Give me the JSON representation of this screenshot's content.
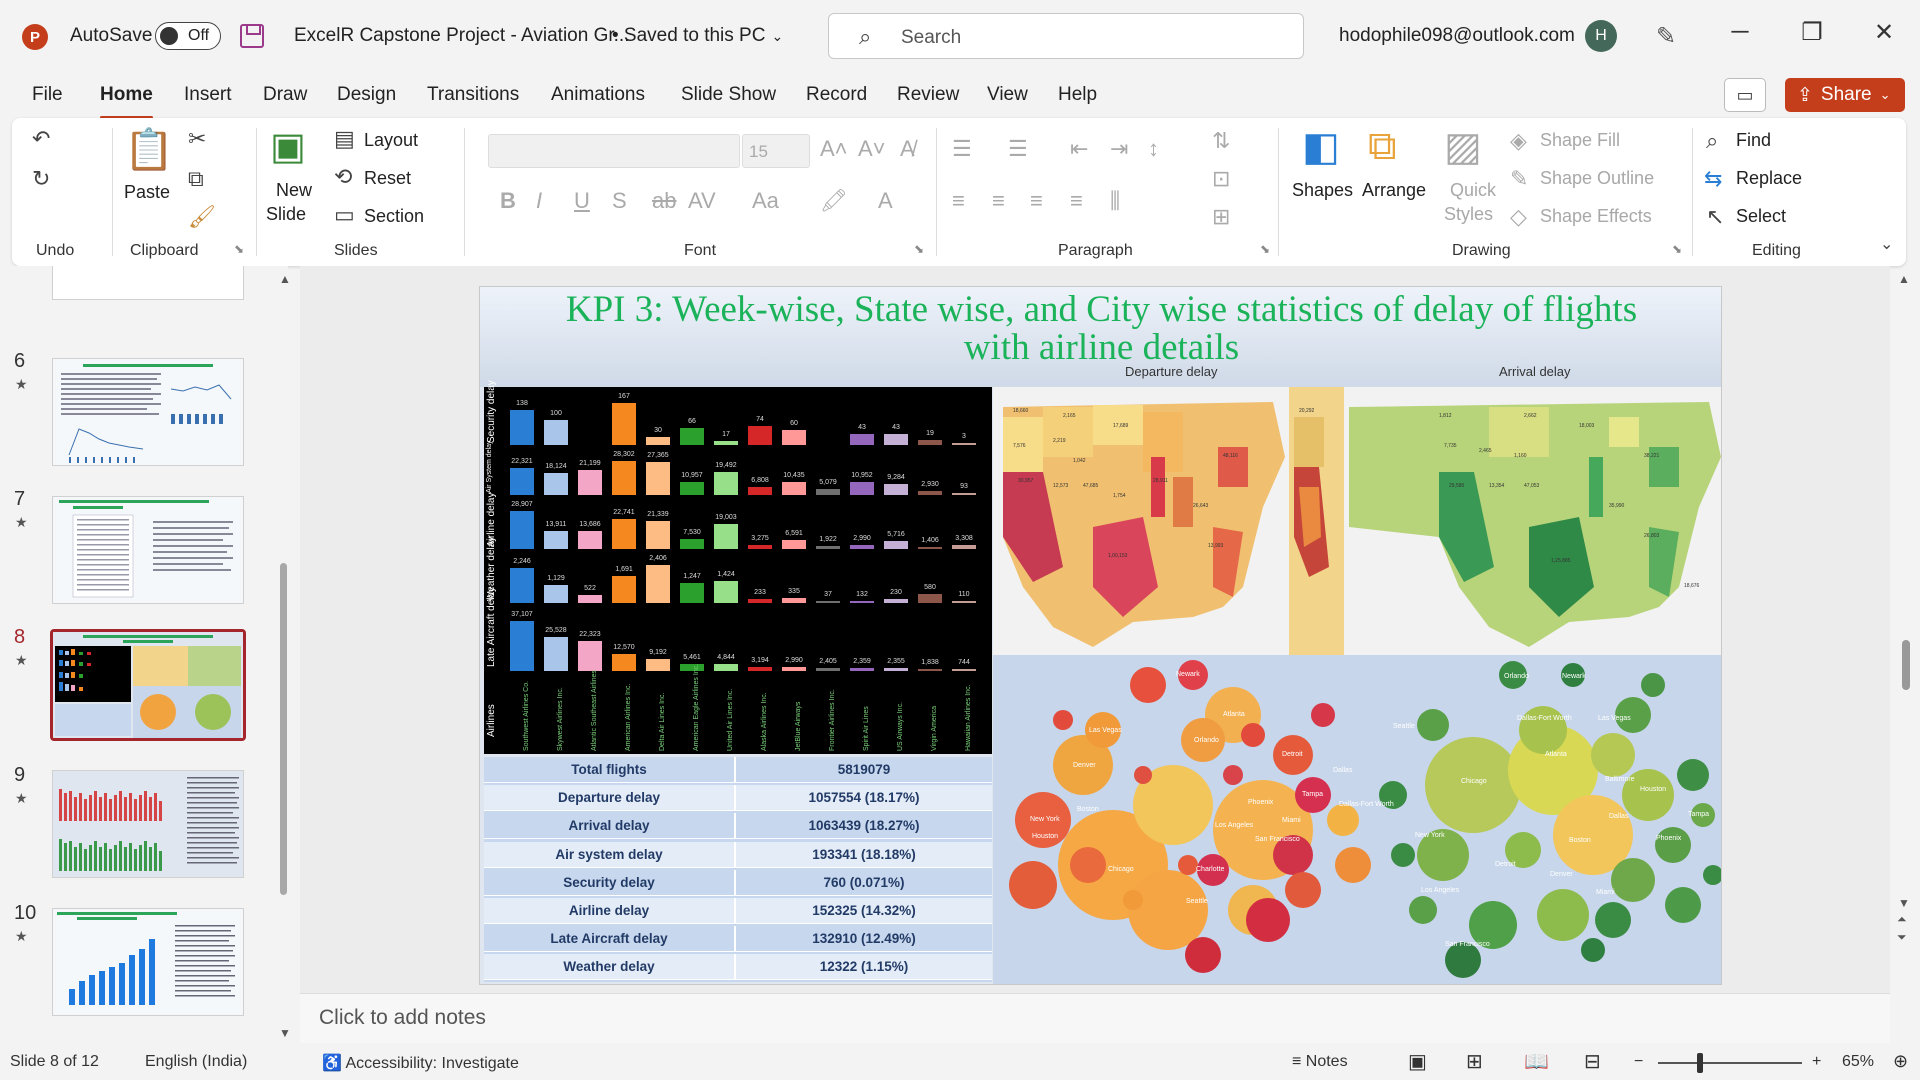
{
  "titlebar": {
    "app_icon": "P",
    "autosave_label": "AutoSave",
    "autosave_state": "Off",
    "doc_title": "ExcelR Capstone Project - Aviation Gr...",
    "doc_status": "• Saved to this PC",
    "search_placeholder": "Search",
    "account": "hodophile098@outlook.com",
    "avatar_initial": "H"
  },
  "menu": {
    "tabs": [
      "File",
      "Home",
      "Insert",
      "Draw",
      "Design",
      "Transitions",
      "Animations",
      "Slide Show",
      "Record",
      "Review",
      "View",
      "Help"
    ],
    "active": "Home",
    "share_label": "Share"
  },
  "ribbon": {
    "groups": {
      "undo": "Undo",
      "clipboard": "Clipboard",
      "slides": "Slides",
      "font": "Font",
      "paragraph": "Paragraph",
      "drawing": "Drawing",
      "editing": "Editing"
    },
    "paste": "Paste",
    "new_slide_1": "New",
    "new_slide_2": "Slide",
    "layout": "Layout",
    "reset": "Reset",
    "section": "Section",
    "font_size": "15",
    "shapes": "Shapes",
    "arrange": "Arrange",
    "quick_styles_1": "Quick",
    "quick_styles_2": "Styles",
    "shape_fill": "Shape Fill",
    "shape_outline": "Shape Outline",
    "shape_effects": "Shape Effects",
    "find": "Find",
    "replace": "Replace",
    "select": "Select"
  },
  "thumbnails": [
    {
      "num": "6",
      "selected": false
    },
    {
      "num": "7",
      "selected": false
    },
    {
      "num": "8",
      "selected": true
    },
    {
      "num": "9",
      "selected": false
    },
    {
      "num": "10",
      "selected": false
    }
  ],
  "slide": {
    "title_line1": "KPI 3: Week-wise, State wise, and City wise statistics of delay of flights",
    "title_line2": "with airline details",
    "departure_label": "Departure delay",
    "arrival_label": "Arrival delay",
    "row_labels": [
      "Security delay",
      "Air System delay",
      "Airline delay",
      "Weather delay",
      "Late Aircraft delay",
      "Airlines"
    ],
    "airlines": [
      "Southwest Airlines Co.",
      "Skywest Airlines Inc.",
      "Atlantic Southeast Airlines",
      "American Airlines Inc.",
      "Delta Air Lines Inc.",
      "American Eagle Airlines Inc.",
      "United Air Lines Inc.",
      "Alaska Airlines Inc.",
      "JetBlue Airways",
      "Frontier Airlines Inc.",
      "Spirit Air Lines",
      "US Airways Inc.",
      "Virgin America",
      "Hawaiian Airlines Inc."
    ],
    "bar_colors": [
      "#2a7fd4",
      "#a9c6ea",
      "#f4a6c6",
      "#f5891f",
      "#fcbc84",
      "#2ca02c",
      "#98df8a",
      "#d62728",
      "#ff9896",
      "#6f6f6f",
      "#9467bd",
      "#c5b0d5",
      "#8c564b",
      "#c49c94"
    ],
    "bar_rows": [
      {
        "values": [
          "138",
          "100",
          "",
          "167",
          "30",
          "66",
          "17",
          "74",
          "60",
          "",
          "43",
          "43",
          "19",
          "3"
        ],
        "heights": [
          138,
          100,
          0,
          167,
          30,
          66,
          17,
          74,
          60,
          0,
          43,
          43,
          19,
          3
        ],
        "max": 167
      },
      {
        "values": [
          "22,321",
          "18,124",
          "21,199",
          "28,302",
          "27,365",
          "10,957",
          "19,492",
          "6,808",
          "10,435",
          "5,079",
          "10,952",
          "9,284",
          "2,930",
          "93"
        ],
        "heights": [
          22321,
          18124,
          21199,
          28302,
          27365,
          10957,
          19492,
          6808,
          10435,
          5079,
          10952,
          9284,
          2930,
          93
        ],
        "max": 28302
      },
      {
        "values": [
          "28,907",
          "13,911",
          "13,686",
          "22,741",
          "21,339",
          "7,530",
          "19,003",
          "3,275",
          "6,591",
          "1,922",
          "2,990",
          "5,716",
          "1,406",
          "3,308"
        ],
        "heights": [
          28907,
          13911,
          13686,
          22741,
          21339,
          7530,
          19003,
          3275,
          6591,
          1922,
          2990,
          5716,
          1406,
          3308
        ],
        "max": 28907
      },
      {
        "values": [
          "2,246",
          "1,129",
          "522",
          "1,691",
          "2,406",
          "1,247",
          "1,424",
          "233",
          "335",
          "37",
          "132",
          "230",
          "580",
          "110"
        ],
        "heights": [
          2246,
          1129,
          522,
          1691,
          2406,
          1247,
          1424,
          233,
          335,
          37,
          132,
          230,
          580,
          110
        ],
        "max": 2406
      },
      {
        "values": [
          "37,107",
          "25,528",
          "22,323",
          "12,570",
          "9,192",
          "5,461",
          "4,844",
          "3,194",
          "2,990",
          "2,405",
          "2,359",
          "2,355",
          "1,838",
          "744"
        ],
        "heights": [
          37107,
          25528,
          22323,
          12570,
          9192,
          5461,
          4844,
          3194,
          2990,
          2405,
          2359,
          2355,
          1838,
          744
        ],
        "max": 37107
      }
    ],
    "stats": [
      {
        "label": "Total flights",
        "value": "5819079"
      },
      {
        "label": "Departure delay",
        "value": "1057554 (18.17%)"
      },
      {
        "label": "Arrival delay",
        "value": "1063439 (18.27%)"
      },
      {
        "label": "Air system delay",
        "value": "193341 (18.18%)"
      },
      {
        "label": "Security delay",
        "value": "760 (0.071%)"
      },
      {
        "label": "Airline delay",
        "value": "152325 (14.32%)"
      },
      {
        "label": "Late Aircraft delay",
        "value": "132910 (12.49%)"
      },
      {
        "label": "Weather delay",
        "value": "12322 (1.15%)"
      }
    ],
    "dep_cities": [
      "Newark",
      "Las Vegas",
      "Atlanta",
      "Orlando",
      "Detroit",
      "Denver",
      "Tampa",
      "Dallas",
      "New York",
      "Boston",
      "Phoenix",
      "Miami",
      "Dallas-Fort Worth",
      "Los Angeles",
      "Houston",
      "San Francisco",
      "Chicago",
      "Charlotte",
      "Seattle"
    ],
    "arr_cities": [
      "Orlando",
      "Newark",
      "Dallas-Fort Worth",
      "Las Vegas",
      "Seattle",
      "Atlanta",
      "Chicago",
      "Baltimore",
      "Houston",
      "Tampa",
      "Dallas",
      "New York",
      "Phoenix",
      "Boston",
      "Detroit",
      "Los Angeles",
      "Denver",
      "Miami",
      "San Francisco"
    ]
  },
  "notes_placeholder": "Click to add notes",
  "status": {
    "slide_info": "Slide 8 of 12",
    "language": "English (India)",
    "accessibility": "Accessibility: Investigate",
    "notes": "Notes",
    "zoom": "65%"
  }
}
